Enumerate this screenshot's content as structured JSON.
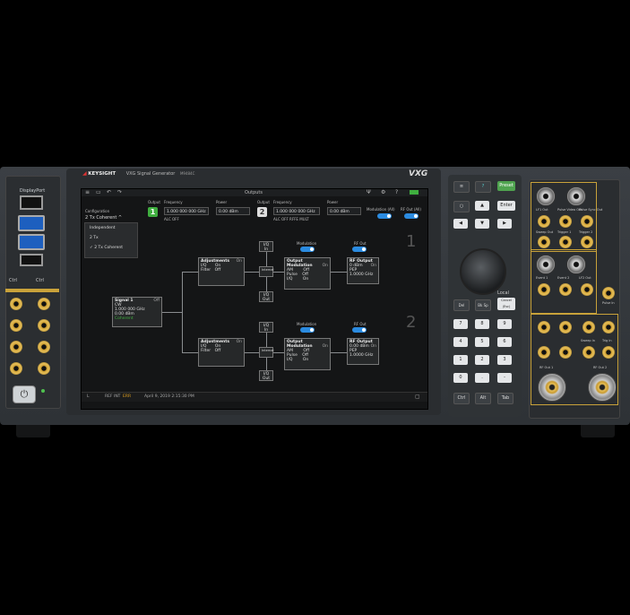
{
  "device": {
    "brand": "KEYSIGHT",
    "model_name": "VXG Signal Generator",
    "model_number": "M9484C",
    "badge": "VXG"
  },
  "left_panel": {
    "displayport_label": "DisplayPort",
    "ctrl_labels": [
      "Ctrl",
      "Ctrl"
    ],
    "power_glyph": "⏻"
  },
  "screen": {
    "header_title": "Outputs",
    "configuration_label": "Configuration",
    "configuration_value": "2 Tx Coherent",
    "dropdown_options": [
      "Independent",
      "2 Tx",
      "2 Tx Coherent"
    ],
    "channel1": {
      "label": "Output",
      "number": "1",
      "frequency_label": "Frequency",
      "frequency_value": "1.000 000 000 GHz",
      "power_label": "Power",
      "power_value": "0.00 dBm",
      "alc": "ALC OFF"
    },
    "channel2": {
      "label": "Output",
      "number": "2",
      "frequency_label": "Frequency",
      "frequency_value": "1.000 000 000 GHz",
      "power_label": "Power",
      "power_value": "0.00 dBm",
      "alc": "ALC OFF   RFFE   MULT"
    },
    "modulation_all_label": "Modulation (All)",
    "rf_out_all_label": "RF Out (All)",
    "big_numbers": [
      "1",
      "2"
    ],
    "signal_block": {
      "title": "Signal 1",
      "state": "Off",
      "lines": [
        "CW",
        "1.000 000 GHz",
        "0.00 dBm"
      ],
      "extra": "Coherent"
    },
    "path1": {
      "iq_in": "I/Q In",
      "iq_out": "I/Q Out",
      "internal": "Internal",
      "modulation_label": "Modulation",
      "rf_out_label": "RF Out",
      "adjust": {
        "title": "Adjustments",
        "state": "On",
        "rows": [
          [
            "I/Q",
            "On"
          ],
          [
            "Filter",
            "Off"
          ]
        ]
      },
      "outmod": {
        "title": "Output Modulation",
        "state": "On",
        "rows": [
          [
            "AM",
            "Off"
          ],
          [
            "Pulse",
            "Off"
          ],
          [
            "I/Q",
            "On"
          ]
        ]
      },
      "rfout": {
        "title": "RF Output",
        "state": "On",
        "rows": [
          "0 dBm PEP",
          "1.0000 GHz"
        ]
      }
    },
    "path2": {
      "iq_in": "I/Q In",
      "iq_out": "I/Q Out",
      "internal": "Internal",
      "modulation_label": "Modulation",
      "rf_out_label": "RF Out",
      "adjust": {
        "title": "Adjustments",
        "state": "On",
        "rows": [
          [
            "I/Q",
            "On"
          ],
          [
            "Filter",
            "Off"
          ]
        ]
      },
      "outmod": {
        "title": "Output Modulation",
        "state": "On",
        "rows": [
          [
            "AM",
            "Off"
          ],
          [
            "Pulse",
            "Off"
          ],
          [
            "I/Q",
            "On"
          ]
        ]
      },
      "rfout": {
        "title": "RF Output",
        "state": "On",
        "rows": [
          "0.00 dBm PEP",
          "1.0000 GHz"
        ]
      }
    },
    "status_left": "L",
    "status_ref": "REF INT",
    "status_warn": "ERR",
    "status_time": "April 9, 2019 2:15:30 PM"
  },
  "keypad": {
    "keys_top": [
      "≡",
      "?",
      "Preset"
    ],
    "keys_row2": [
      "○",
      "▲",
      "Enter"
    ],
    "keys_row3": [
      "◀",
      "▼",
      "▶"
    ],
    "local_label": "Local",
    "func_keys": [
      "Del",
      "Bk Sp",
      "Cancel (Esc)"
    ],
    "num_rows": [
      [
        "7",
        "8",
        "9"
      ],
      [
        "4",
        "5",
        "6"
      ],
      [
        "1",
        "2",
        "3"
      ],
      [
        "0",
        ".",
        "-"
      ]
    ],
    "bottom_keys": [
      "Ctrl",
      "Alt",
      "Tab"
    ]
  },
  "right_panel": {
    "labels": [
      "LF1 Out",
      "Pulse Video Out",
      "Pulse Sync Out",
      "Sweep Out",
      "Trigger 1",
      "Trigger 2",
      "Event 1",
      "Event 2",
      "LF2 Out",
      "Pulse In",
      "Sweep In",
      "Trig In",
      "RF Out 1",
      "RF Out 2"
    ]
  },
  "colors": {
    "accent_blue": "#2b8be0",
    "channel1_green": "#3fae3f",
    "preset_green": "#4fa34f"
  }
}
